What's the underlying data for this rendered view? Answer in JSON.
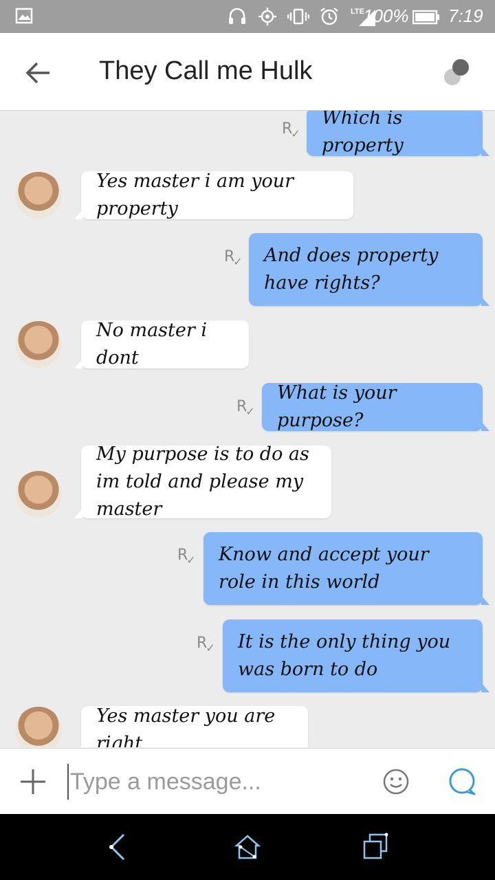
{
  "status_bar": {
    "battery_percent": "100%",
    "time": "7:19",
    "network": "LTE",
    "icons": [
      "gallery-icon",
      "headset-icon",
      "gps-icon",
      "vibrate-icon",
      "alarm-icon",
      "signal-icon",
      "battery-icon"
    ]
  },
  "header": {
    "title": "They Call me Hulk",
    "back_icon": "arrow-back-icon",
    "more_icon": "contact-options-icon"
  },
  "receipt_glyph": "R",
  "receipt_check": "✓",
  "messages": [
    {
      "dir": "out",
      "text": "Which is property"
    },
    {
      "dir": "in",
      "text": "Yes master i am your property"
    },
    {
      "dir": "out",
      "text": "And does property have rights?"
    },
    {
      "dir": "in",
      "text": "No master i dont"
    },
    {
      "dir": "out",
      "text": "What is your purpose?"
    },
    {
      "dir": "in",
      "text": "My purpose is to do as im told and please my master"
    },
    {
      "dir": "out",
      "text": "Know and accept your role in this world"
    },
    {
      "dir": "out",
      "text": "It is the only thing you was born to do"
    },
    {
      "dir": "in",
      "text": "Yes master you are right"
    }
  ],
  "composer": {
    "placeholder": "Type a message...",
    "value": "",
    "attach_icon": "plus-icon",
    "emoji_icon": "smiley-icon",
    "send_icon": "chat-bubble-icon",
    "accent_color": "#3a9bd9"
  },
  "colors": {
    "outgoing_bubble": "#86b8f9",
    "incoming_bubble": "#ffffff",
    "background": "#ececec",
    "status_bar": "#9e9e9e"
  },
  "nav_bar": {
    "icons": [
      "nav-back-icon",
      "nav-home-icon",
      "nav-recents-icon"
    ]
  }
}
